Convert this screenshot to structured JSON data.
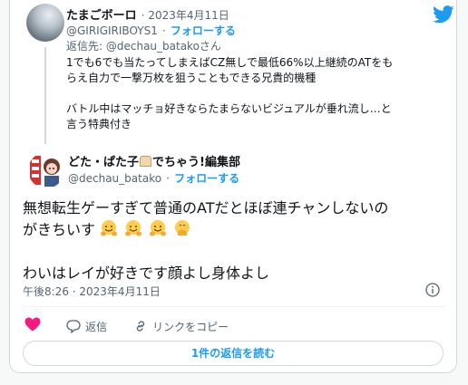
{
  "reply_to_tweet": {
    "display_name": "たまごボーロ",
    "date": "· 2023年4月11日",
    "handle": "@GIRIGIRIBOYS1",
    "follow_sep": "·",
    "follow_label": "フォローする",
    "reply_prefix": "返信先: ",
    "reply_handle": "@dechau_batako",
    "reply_suffix": "さん",
    "text_line1": "1でも6でも当たってしまえばCZ無しで最低66%以上継続のATをも",
    "text_line2": "らえ自力で一撃万枚を狙うこともできる兄貴的機種",
    "text_line3": "バトル中はマッチョ好きならたまらないビジュアルが垂れ流し…と",
    "text_line4": "言う特典付き"
  },
  "main_tweet": {
    "display_name": "どた・ぱた子",
    "display_name_suffix": "でちゃう!編集部",
    "handle": "@dechau_batako",
    "follow_sep": "·",
    "follow_label": "フォローする",
    "text_line1": "無想転生ゲーすぎて普通のATだとほぼ連チャンしないの",
    "text_line2": "がきちいす",
    "text_line3": "わいはレイが好きです顔よし身体よし",
    "timestamp": "午後8:26 · 2023年4月11日"
  },
  "actions": {
    "reply_label": "返信",
    "copy_link_label": "リンクをコピー"
  },
  "read_replies_label": "1件の返信を読む",
  "colors": {
    "accent": "#1d9bf0",
    "like": "#f91880",
    "text": "#0f1419",
    "muted": "#536471"
  },
  "icons": [
    "twitter-bird-icon",
    "info-icon",
    "heart-icon",
    "reply-icon",
    "link-icon",
    "hugging-face-emoji",
    "face-with-hand-emoji"
  ]
}
